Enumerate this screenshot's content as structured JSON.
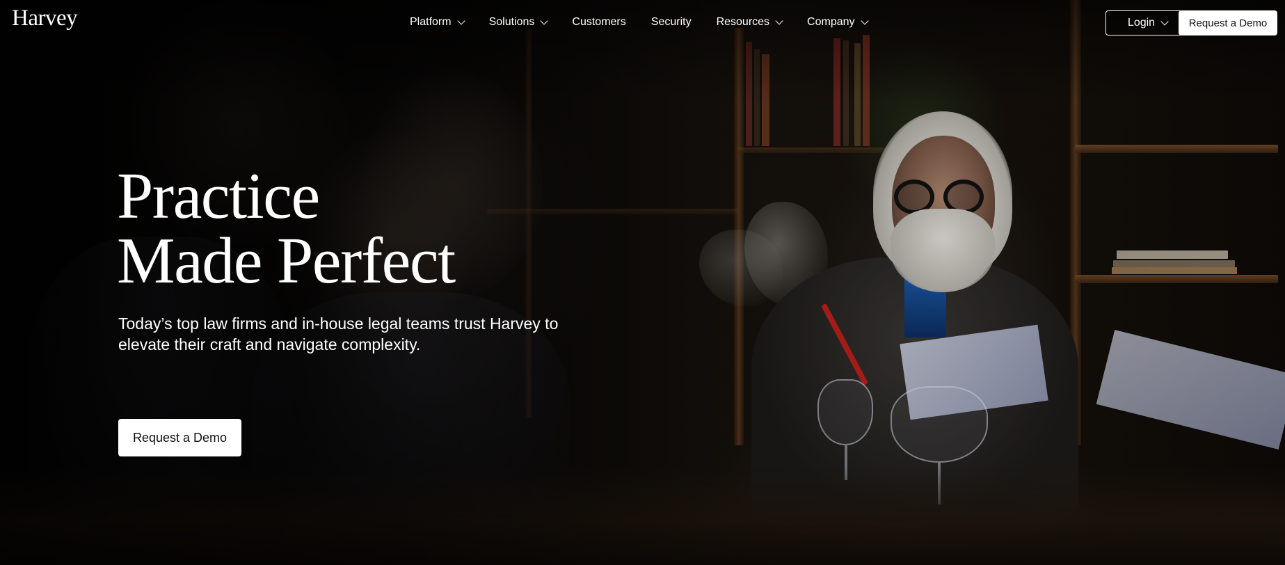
{
  "brand": {
    "logo_text": "Harvey"
  },
  "nav": {
    "items": [
      {
        "label": "Platform",
        "has_dropdown": true
      },
      {
        "label": "Solutions",
        "has_dropdown": true
      },
      {
        "label": "Customers",
        "has_dropdown": false
      },
      {
        "label": "Security",
        "has_dropdown": false
      },
      {
        "label": "Resources",
        "has_dropdown": true
      },
      {
        "label": "Company",
        "has_dropdown": true
      }
    ],
    "login_label": "Login",
    "demo_label": "Request a Demo"
  },
  "hero": {
    "title_line1": "Practice",
    "title_line2": "Made Perfect",
    "subtitle": "Today’s top law firms and in-house legal teams trust Harvey to elevate their craft and navigate complexity.",
    "cta_label": "Request a Demo",
    "background_image": "man-in-conference-room-photo"
  },
  "colors": {
    "background": "#050403",
    "text": "#ffffff",
    "button_bg": "#ffffff",
    "button_text": "#111111"
  }
}
